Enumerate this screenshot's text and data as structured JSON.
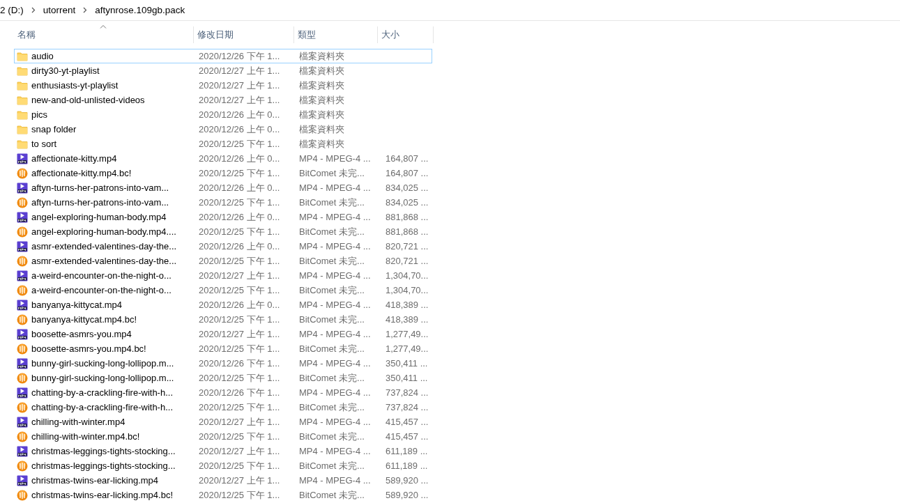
{
  "breadcrumb": [
    "2 (D:)",
    "utorrent",
    "aftynrose.109gb.pack"
  ],
  "columns": [
    {
      "label": "名稱",
      "sorted": true
    },
    {
      "label": "修改日期",
      "sorted": false
    },
    {
      "label": "類型",
      "sorted": false
    },
    {
      "label": "大小",
      "sorted": false
    }
  ],
  "rows": [
    {
      "kind": "folder",
      "name": "audio",
      "date": "2020/12/26 下午 1...",
      "type": "檔案資料夾",
      "selected": true
    },
    {
      "kind": "folder",
      "name": "dirty30-yt-playlist",
      "date": "2020/12/27 上午 1...",
      "type": "檔案資料夾",
      "selected": false
    },
    {
      "kind": "folder",
      "name": "enthusiasts-yt-playlist",
      "date": "2020/12/27 上午 1...",
      "type": "檔案資料夾",
      "selected": false
    },
    {
      "kind": "folder",
      "name": "new-and-old-unlisted-videos",
      "date": "2020/12/27 上午 1...",
      "type": "檔案資料夾",
      "selected": false
    },
    {
      "kind": "folder",
      "name": "pics",
      "date": "2020/12/26 上午 0...",
      "type": "檔案資料夾",
      "selected": false
    },
    {
      "kind": "folder",
      "name": "snap folder",
      "date": "2020/12/26 上午 0...",
      "type": "檔案資料夾",
      "selected": false
    },
    {
      "kind": "folder",
      "name": "to sort",
      "date": "2020/12/25 下午 1...",
      "type": "檔案資料夾",
      "selected": false
    },
    {
      "kind": "mp4",
      "name": "affectionate-kitty.mp4",
      "date": "2020/12/26 上午 0...",
      "type": "MP4 - MPEG-4 ...",
      "size": "164,807 ...",
      "selected": false
    },
    {
      "kind": "bitcomet",
      "name": "affectionate-kitty.mp4.bc!",
      "date": "2020/12/25 下午 1...",
      "type": "BitComet 未完...",
      "size": "164,807 ...",
      "selected": false
    },
    {
      "kind": "mp4",
      "name": "aftyn-turns-her-patrons-into-vam...",
      "date": "2020/12/26 上午 0...",
      "type": "MP4 - MPEG-4 ...",
      "size": "834,025 ...",
      "selected": false
    },
    {
      "kind": "bitcomet",
      "name": "aftyn-turns-her-patrons-into-vam...",
      "date": "2020/12/25 下午 1...",
      "type": "BitComet 未完...",
      "size": "834,025 ...",
      "selected": false
    },
    {
      "kind": "mp4",
      "name": "angel-exploring-human-body.mp4",
      "date": "2020/12/26 上午 0...",
      "type": "MP4 - MPEG-4 ...",
      "size": "881,868 ...",
      "selected": false
    },
    {
      "kind": "bitcomet",
      "name": "angel-exploring-human-body.mp4....",
      "date": "2020/12/25 下午 1...",
      "type": "BitComet 未完...",
      "size": "881,868 ...",
      "selected": false
    },
    {
      "kind": "mp4",
      "name": "asmr-extended-valentines-day-the...",
      "date": "2020/12/26 上午 0...",
      "type": "MP4 - MPEG-4 ...",
      "size": "820,721 ...",
      "selected": false
    },
    {
      "kind": "bitcomet",
      "name": "asmr-extended-valentines-day-the...",
      "date": "2020/12/25 下午 1...",
      "type": "BitComet 未完...",
      "size": "820,721 ...",
      "selected": false
    },
    {
      "kind": "mp4",
      "name": "a-weird-encounter-on-the-night-o...",
      "date": "2020/12/27 上午 1...",
      "type": "MP4 - MPEG-4 ...",
      "size": "1,304,70...",
      "selected": false
    },
    {
      "kind": "bitcomet",
      "name": "a-weird-encounter-on-the-night-o...",
      "date": "2020/12/25 下午 1...",
      "type": "BitComet 未完...",
      "size": "1,304,70...",
      "selected": false
    },
    {
      "kind": "mp4",
      "name": "banyanya-kittycat.mp4",
      "date": "2020/12/26 上午 0...",
      "type": "MP4 - MPEG-4 ...",
      "size": "418,389 ...",
      "selected": false
    },
    {
      "kind": "bitcomet",
      "name": "banyanya-kittycat.mp4.bc!",
      "date": "2020/12/25 下午 1...",
      "type": "BitComet 未完...",
      "size": "418,389 ...",
      "selected": false
    },
    {
      "kind": "mp4",
      "name": "boosette-asmrs-you.mp4",
      "date": "2020/12/27 上午 1...",
      "type": "MP4 - MPEG-4 ...",
      "size": "1,277,49...",
      "selected": false
    },
    {
      "kind": "bitcomet",
      "name": "boosette-asmrs-you.mp4.bc!",
      "date": "2020/12/25 下午 1...",
      "type": "BitComet 未完...",
      "size": "1,277,49...",
      "selected": false
    },
    {
      "kind": "mp4",
      "name": "bunny-girl-sucking-long-lollipop.m...",
      "date": "2020/12/26 下午 1...",
      "type": "MP4 - MPEG-4 ...",
      "size": "350,411 ...",
      "selected": false
    },
    {
      "kind": "bitcomet",
      "name": "bunny-girl-sucking-long-lollipop.m...",
      "date": "2020/12/25 下午 1...",
      "type": "BitComet 未完...",
      "size": "350,411 ...",
      "selected": false
    },
    {
      "kind": "mp4",
      "name": "chatting-by-a-crackling-fire-with-h...",
      "date": "2020/12/26 下午 1...",
      "type": "MP4 - MPEG-4 ...",
      "size": "737,824 ...",
      "selected": false
    },
    {
      "kind": "bitcomet",
      "name": "chatting-by-a-crackling-fire-with-h...",
      "date": "2020/12/25 下午 1...",
      "type": "BitComet 未完...",
      "size": "737,824 ...",
      "selected": false
    },
    {
      "kind": "mp4",
      "name": "chilling-with-winter.mp4",
      "date": "2020/12/27 上午 1...",
      "type": "MP4 - MPEG-4 ...",
      "size": "415,457 ...",
      "selected": false
    },
    {
      "kind": "bitcomet",
      "name": "chilling-with-winter.mp4.bc!",
      "date": "2020/12/25 下午 1...",
      "type": "BitComet 未完...",
      "size": "415,457 ...",
      "selected": false
    },
    {
      "kind": "mp4",
      "name": "christmas-leggings-tights-stocking...",
      "date": "2020/12/27 上午 1...",
      "type": "MP4 - MPEG-4 ...",
      "size": "611,189 ...",
      "selected": false
    },
    {
      "kind": "bitcomet",
      "name": "christmas-leggings-tights-stocking...",
      "date": "2020/12/25 下午 1...",
      "type": "BitComet 未完...",
      "size": "611,189 ...",
      "selected": false
    },
    {
      "kind": "mp4",
      "name": "christmas-twins-ear-licking.mp4",
      "date": "2020/12/27 上午 1...",
      "type": "MP4 - MPEG-4 ...",
      "size": "589,920 ...",
      "selected": false
    },
    {
      "kind": "bitcomet",
      "name": "christmas-twins-ear-licking.mp4.bc!",
      "date": "2020/12/25 下午 1...",
      "type": "BitComet 未完...",
      "size": "589,920 ...",
      "selected": false
    }
  ]
}
